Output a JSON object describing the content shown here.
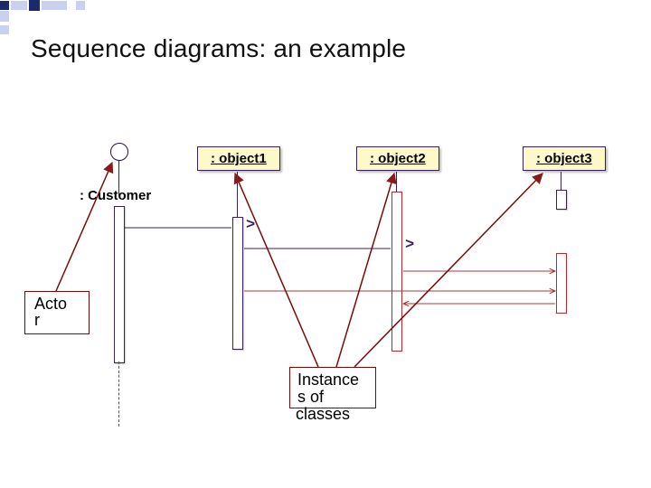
{
  "title": "Sequence diagrams: an example",
  "actor_label": ": Customer",
  "objects": {
    "o1": ": object1",
    "o2": ": object2",
    "o3": ": object3"
  },
  "annotations": {
    "actor_box_line1": "Acto",
    "actor_box_line2": "r",
    "instances_line1": "Instance",
    "instances_line2": "s of",
    "instances_line3": "classes"
  },
  "markers": {
    "chev1": ">",
    "chev2": ">"
  }
}
